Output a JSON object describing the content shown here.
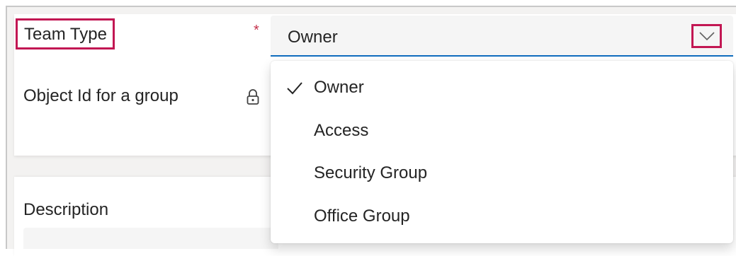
{
  "form": {
    "team_type": {
      "label": "Team Type",
      "required_marker": "*",
      "selected_value": "Owner"
    },
    "object_id": {
      "label": "Object Id for a group"
    },
    "description": {
      "label": "Description"
    }
  },
  "dropdown": {
    "options": [
      {
        "label": "Owner",
        "selected": true
      },
      {
        "label": "Access",
        "selected": false
      },
      {
        "label": "Security Group",
        "selected": false
      },
      {
        "label": "Office Group",
        "selected": false
      }
    ]
  },
  "icons": {
    "chevron": "chevron-down-icon",
    "lock": "lock-icon",
    "check": "checkmark-icon"
  },
  "colors": {
    "highlight": "#c21753",
    "accent": "#0f6cbd",
    "required": "#c4314b"
  }
}
